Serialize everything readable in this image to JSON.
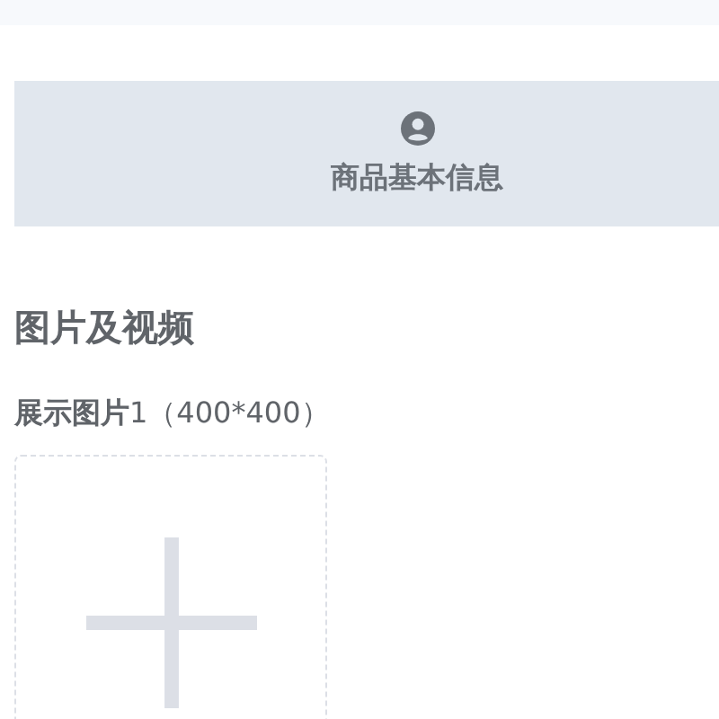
{
  "step_tab": {
    "label": "商品基本信息",
    "selected": true
  },
  "section": {
    "title": "图片及视频"
  },
  "upload": {
    "label": "**展示图片**1（400*400）"
  }
}
